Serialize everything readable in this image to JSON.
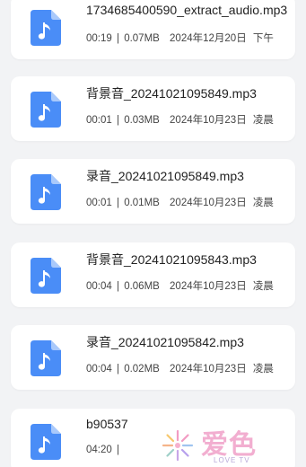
{
  "files": [
    {
      "name": "1734685400590_extract_audio.mp3",
      "duration": "00:19",
      "size": "0.07MB",
      "date": "2024年12月20日",
      "period": "下午"
    },
    {
      "name": "背景音_20241021095849.mp3",
      "duration": "00:01",
      "size": "0.03MB",
      "date": "2024年10月23日",
      "period": "凌晨"
    },
    {
      "name": "录音_20241021095849.mp3",
      "duration": "00:01",
      "size": "0.01MB",
      "date": "2024年10月23日",
      "period": "凌晨"
    },
    {
      "name": "背景音_20241021095843.mp3",
      "duration": "00:04",
      "size": "0.06MB",
      "date": "2024年10月23日",
      "period": "凌晨"
    },
    {
      "name": "录音_20241021095842.mp3",
      "duration": "00:04",
      "size": "0.02MB",
      "date": "2024年10月23日",
      "period": "凌晨"
    },
    {
      "name": "b90537",
      "duration": "04:20",
      "size": "",
      "date": "",
      "period": ""
    }
  ],
  "separator": "|",
  "icon": "music-file-icon",
  "colors": {
    "icon_bg": "#4a8df7",
    "icon_fold": "#a9c9fb",
    "card": "#ffffff",
    "background": "#f2f3f5"
  },
  "watermark": {
    "text": "爱色",
    "subtext": "LOVE TV",
    "logo": "snowflake-logo"
  }
}
